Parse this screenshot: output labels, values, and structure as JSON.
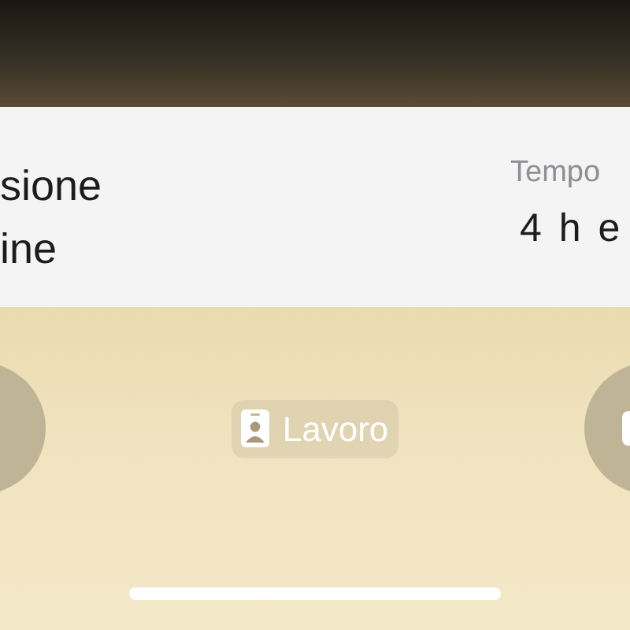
{
  "live_activity": {
    "title_lines": [
      "sione",
      "ine"
    ],
    "time_label": "Tempo",
    "time_value": "4 h e"
  },
  "focus": {
    "label": "Lavoro"
  }
}
